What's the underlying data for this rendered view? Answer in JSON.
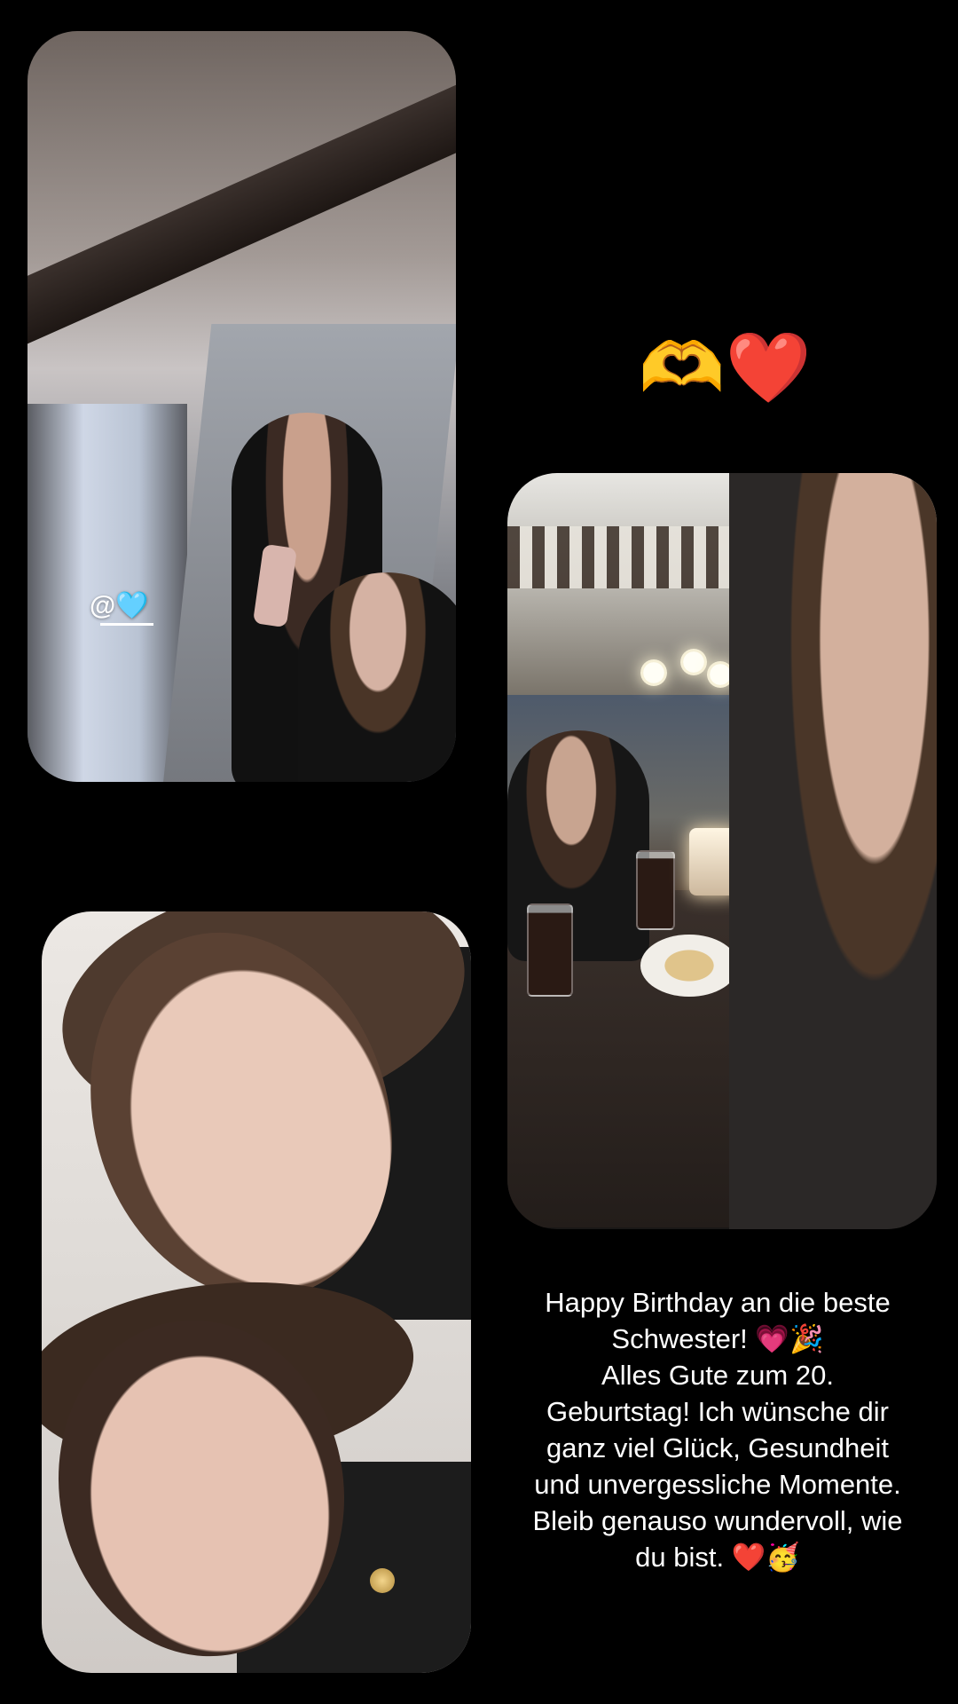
{
  "photos": {
    "top_left": {
      "tag": "@🩵"
    }
  },
  "hearts_emoji": "🫶❤️",
  "caption": {
    "lines": [
      "Happy Birthday an die beste",
      "Schwester! 💗🎉",
      "Alles Gute zum 20.",
      "Geburtstag! Ich wünsche dir",
      "ganz viel Glück, Gesundheit",
      "und unvergessliche Momente.",
      "Bleib genauso wundervoll, wie",
      "du bist. ❤️🥳"
    ]
  }
}
